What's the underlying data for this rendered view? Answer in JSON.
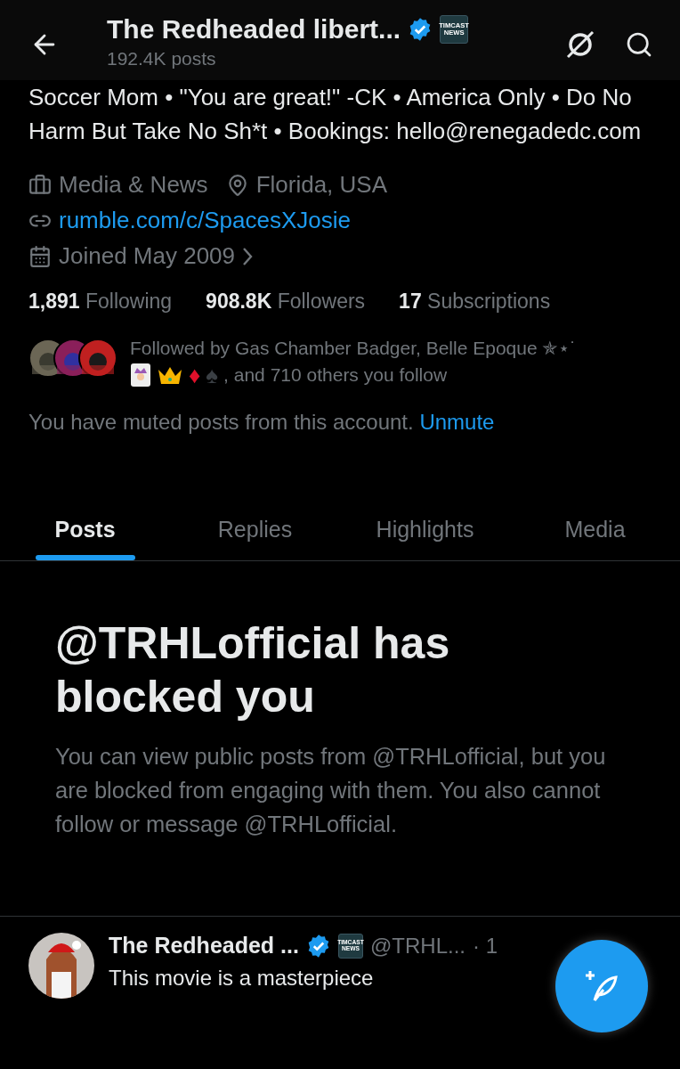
{
  "header": {
    "title": "The Redheaded libert...",
    "verified": true,
    "affiliate_badge": "TIMCAST NEWS",
    "subtitle": "192.4K posts"
  },
  "bio": "Soccer Mom • \"You are great!\" -CK • America Only • Do No Harm But Take No Sh*t • Bookings: hello@renegadedc.com",
  "meta": [
    {
      "kind": "category",
      "text": "Media & News"
    },
    {
      "kind": "location",
      "text": "Florida, USA"
    },
    {
      "kind": "link",
      "text": "rumble.com/c/SpacesXJosie"
    },
    {
      "kind": "joined",
      "text": "Joined May 2009"
    }
  ],
  "stats": [
    {
      "count": "1,891",
      "label": "Following"
    },
    {
      "count": "908.8K",
      "label": "Followers"
    },
    {
      "count": "17",
      "label": "Subscriptions"
    }
  ],
  "followed_by": {
    "text": "Followed by Gas Chamber Badger, Belle Epoque ✯⋆˙",
    "suits": "♦",
    "spade": "♠",
    "rest": ", and 710 others you follow"
  },
  "muted": {
    "text": "You have muted posts from this account.",
    "action": "Unmute"
  },
  "tabs": [
    {
      "label": "Posts",
      "selected": true
    },
    {
      "label": "Replies",
      "selected": false
    },
    {
      "label": "Highlights",
      "selected": false
    },
    {
      "label": "Media",
      "selected": false
    }
  ],
  "blocked": {
    "title": "@TRHLofficial has blocked you",
    "body": "You can view public posts from @TRHLofficial, but you are blocked from engaging with them. You also cannot follow or message @TRHLofficial."
  },
  "post": {
    "name": "The Redheaded ...",
    "verified": true,
    "affiliate_badge": "TIMCAST NEWS",
    "handle": "@TRHL...",
    "time": "· 1",
    "text": "This movie is a masterpiece"
  }
}
